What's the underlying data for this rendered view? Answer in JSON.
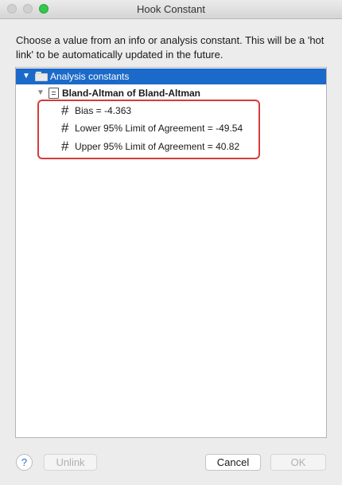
{
  "window": {
    "title": "Hook Constant"
  },
  "prompt": "Choose a value from an info or analysis constant. This will be a 'hot link' to be automatically updated in the future.",
  "tree": {
    "root": {
      "label": "Analysis constants",
      "expanded": true,
      "selected": true,
      "icon": "folder-icon"
    },
    "group": {
      "label": "Bland-Altman of Bland-Altman",
      "expanded": true,
      "icon": "document-icon"
    },
    "constants": [
      {
        "label": "Bias = -4.363",
        "icon": "hash-icon"
      },
      {
        "label": "Lower 95% Limit of Agreement = -49.54",
        "icon": "hash-icon"
      },
      {
        "label": "Upper 95% Limit of Agreement = 40.82",
        "icon": "hash-icon"
      }
    ],
    "highlight_color": "#d63b3b",
    "selection_color": "#1b6ac9"
  },
  "buttons": {
    "help": "?",
    "unlink": "Unlink",
    "cancel": "Cancel",
    "ok": "OK"
  }
}
